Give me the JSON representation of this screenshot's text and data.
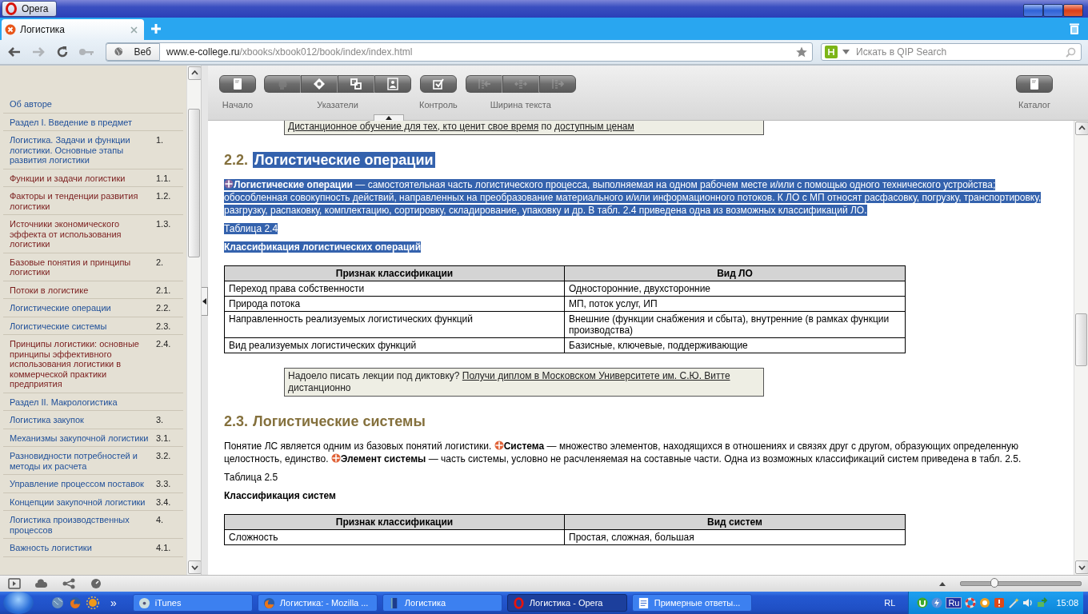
{
  "title_bar": {
    "menu_button": "Opera"
  },
  "tabs": [
    {
      "label": "Логистика",
      "selected": true
    }
  ],
  "address_bar": {
    "nav": [
      {
        "kind": "back",
        "disabled": false
      },
      {
        "kind": "forward",
        "disabled": true
      },
      {
        "kind": "reload",
        "disabled": false
      },
      {
        "kind": "key",
        "disabled": true
      }
    ],
    "scope_button": "Веб",
    "url_host": "www.e-college.ru",
    "url_path": "/xbooks/xbook012/book/index/index.html",
    "search_placeholder": "Искать в QIP Search"
  },
  "sidebar": {
    "items": [
      {
        "title": "Об авторе",
        "visited": false
      },
      {
        "title": "Раздел I. Введение в предмет",
        "visited": false
      },
      {
        "title": "Логистика. Задачи и функции логистики. Основные этапы развития логистики",
        "number": "1.",
        "visited": false
      },
      {
        "title": "Функции и задачи логистики",
        "number": "1.1.",
        "visited": true
      },
      {
        "title": "Факторы и тенденции развития логистики",
        "number": "1.2.",
        "visited": true
      },
      {
        "title": "Источники экономического эффекта от использования логистики",
        "number": "1.3.",
        "visited": true
      },
      {
        "title": "Базовые понятия и принципы логистики",
        "number": "2.",
        "visited": true
      },
      {
        "title": "Потоки в логистике",
        "number": "2.1.",
        "visited": true
      },
      {
        "title": "Логистические операции",
        "number": "2.2.",
        "visited": false
      },
      {
        "title": "Логистические системы",
        "number": "2.3.",
        "visited": false
      },
      {
        "title": "Принципы логистики: основные принципы эффективного использования логистики в коммерческой практики предприятия",
        "number": "2.4.",
        "visited": true
      },
      {
        "title": "Раздел II. Макрологистика",
        "visited": false
      },
      {
        "title": "Логистика закупок",
        "number": "3.",
        "visited": false
      },
      {
        "title": "Механизмы закупочной логистики",
        "number": "3.1.",
        "visited": false
      },
      {
        "title": "Разновидности потребностей и методы их расчета",
        "number": "3.2.",
        "visited": false
      },
      {
        "title": "Управление процессом поставок",
        "number": "3.3.",
        "visited": false
      },
      {
        "title": "Концепции закупочной логистики",
        "number": "3.4.",
        "visited": false
      },
      {
        "title": "Логистика производственных процессов",
        "number": "4.",
        "visited": false
      },
      {
        "title": "Важность логистики",
        "number": "4.1.",
        "visited": false
      }
    ]
  },
  "toolbar": {
    "groups": [
      {
        "label": "Начало",
        "buttons": [
          {
            "disabled": false
          }
        ]
      },
      {
        "label": "Указатели",
        "buttons": [
          {
            "disabled": true
          },
          {
            "disabled": false
          },
          {
            "disabled": false
          },
          {
            "disabled": false
          }
        ]
      },
      {
        "label": "Контроль",
        "buttons": [
          {
            "disabled": false
          }
        ]
      },
      {
        "label": "Ширина текста",
        "buttons": [
          {
            "disabled": true
          },
          {
            "disabled": true
          },
          {
            "disabled": true
          }
        ]
      }
    ],
    "catalog": {
      "label": "Каталог",
      "buttons": [
        {
          "disabled": false
        }
      ]
    }
  },
  "content": {
    "blocks": [
      {
        "kind": "ad",
        "parts": [
          {
            "text": "Дистанционное обучение для тех, кто ценит свое время",
            "link": true
          },
          {
            "text": "по",
            "link": false
          },
          {
            "text": "доступным ценам",
            "link": true
          }
        ]
      },
      {
        "kind": "heading",
        "number": "2.2.",
        "title": "Логистические операции",
        "selected": true
      },
      {
        "kind": "paragraph",
        "selected": true,
        "definitions": [
          "**Логистические операции** — самостоятельная часть логистического процесса, выполняемая на одном рабочем месте и/или с помощью одного технического устройства; обособленная совокупность действий, направленных на преобразование материального и/или информационного потоков. К ЛО с МП относят расфасовку, погрузку, транспортировку, разгрузку, распаковку, комплектацию, сортировку, складирование, упаковку и др. В табл. 2.4 приведена одна из возможных классификаций ЛО."
        ]
      },
      {
        "kind": "caption",
        "text": "Таблица 2.4",
        "selected": true
      },
      {
        "kind": "table_title",
        "text": "Классификация логистических операций",
        "selected": true
      },
      {
        "kind": "table",
        "columns": [
          "Признак классификации",
          "Вид ЛО"
        ],
        "rows": [
          [
            "Переход права собственности",
            "Односторонние, двухсторонние"
          ],
          [
            "Природа потока",
            "МП, поток услуг, ИП"
          ],
          [
            "Направленность реализуемых логистических функций",
            "Внешние (функции снабжения и сбыта), внутренние (в рамках функции производства)"
          ],
          [
            "Вид реализуемых логистических функций",
            "Базисные, ключевые, поддерживающие"
          ]
        ]
      },
      {
        "kind": "ad",
        "parts": [
          {
            "text": "Надоело писать лекции под диктовку?",
            "link": false
          },
          {
            "text": "Получи диплом в Московском Университете им. С.Ю. Витте",
            "link": true
          },
          {
            "text": "дистанционно",
            "link": false
          }
        ]
      },
      {
        "kind": "heading",
        "number": "2.3.",
        "title": "Логистические системы",
        "selected": false
      },
      {
        "kind": "paragraph",
        "selected": false,
        "lead": "Понятие ЛС является одним из базовых понятий логистики.",
        "definitions": [
          "**Система** — множество элементов, находящихся в отношениях и связях друг с другом, образующих определенную целостность, единство.",
          "**Элемент системы** — часть системы, условно не расчленяемая на составные части. Одна из возможных классификаций систем приведена в табл. 2.5."
        ]
      },
      {
        "kind": "caption",
        "text": "Таблица 2.5",
        "selected": false
      },
      {
        "kind": "table_title",
        "text": "Классификация систем",
        "selected": false
      },
      {
        "kind": "table",
        "columns": [
          "Признак классификации",
          "Вид систем"
        ],
        "rows": [
          [
            "Сложность",
            "Простая, сложная, большая"
          ]
        ]
      }
    ]
  },
  "status_bar": {
    "zoom": {
      "level": 0.28
    }
  },
  "taskbar": {
    "more": "»",
    "tasks": [
      {
        "label": "iTunes",
        "selected": false
      },
      {
        "label": "Логистика: - Mozilla ...",
        "selected": false
      },
      {
        "label": "Логистика",
        "selected": false
      },
      {
        "label": "Логистика - Opera",
        "selected": true
      },
      {
        "label": "Примерные ответы...",
        "selected": false
      }
    ],
    "tray": {
      "language": "RL",
      "input": "Ru",
      "time": "15:08"
    }
  }
}
